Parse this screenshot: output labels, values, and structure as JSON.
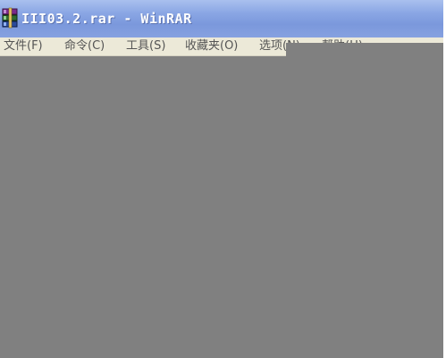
{
  "window": {
    "title": "III03.2.rar - WinRAR",
    "icon": "winrar-books-icon"
  },
  "menu": {
    "items": [
      {
        "label": "文件(F)"
      },
      {
        "label": "命令(C)"
      },
      {
        "label": "工具(S)"
      },
      {
        "label": "收藏夹(O)"
      },
      {
        "label": "选项(N)"
      },
      {
        "label": "帮助(H)"
      }
    ]
  },
  "colors": {
    "title_bar": "#8aa6e4",
    "menu_bar": "#ece9d8",
    "content": "#808080"
  }
}
